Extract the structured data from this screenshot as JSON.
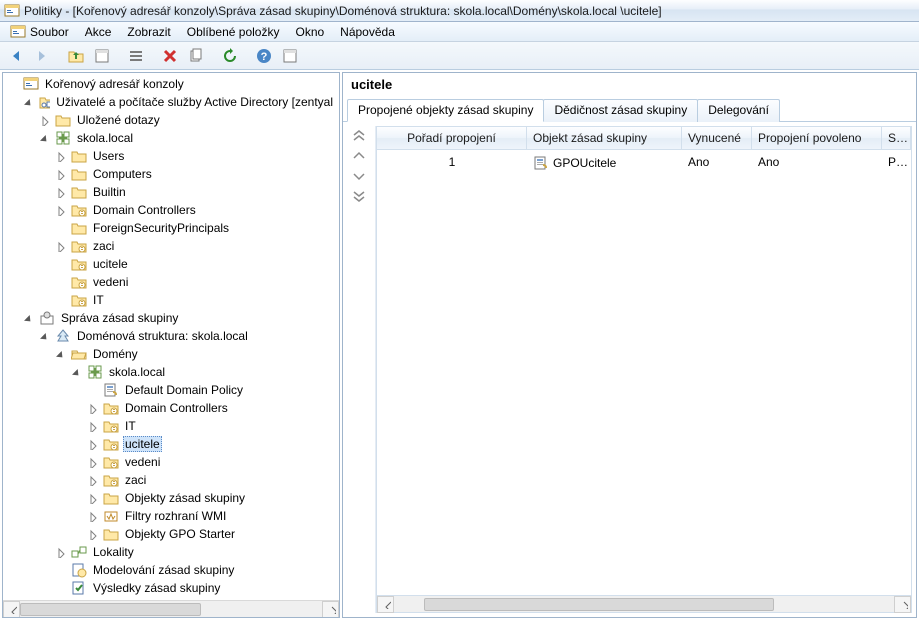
{
  "title": "Politiky - [Kořenový adresář konzoly\\Správa zásad skupiny\\Doménová struktura: skola.local\\Domény\\skola.local \\ucitele]",
  "menu": {
    "file": "Soubor",
    "action": "Akce",
    "view": "Zobrazit",
    "favorites": "Oblíbené položky",
    "window": "Okno",
    "help": "Nápověda"
  },
  "tree": {
    "root": "Kořenový adresář konzoly",
    "aduc": "Uživatelé a počítače služby Active Directory [zentyal",
    "savedQueries": "Uložené dotazy",
    "domain": "skola.local",
    "ou": {
      "users": "Users",
      "computers": "Computers",
      "builtin": "Builtin",
      "dc": "Domain Controllers",
      "fsp": "ForeignSecurityPrincipals",
      "zaci": "zaci",
      "ucitele": "ucitele",
      "vedeni": "vedeni",
      "it": "IT"
    },
    "gpm": "Správa zásad skupiny",
    "forest": "Doménová struktura: skola.local",
    "domains": "Domény",
    "domain2": "skola.local",
    "gpo": {
      "ddp": "Default Domain Policy",
      "dc": "Domain Controllers",
      "it": "IT",
      "ucitele": "ucitele",
      "vedeni": "vedeni",
      "zaci": "zaci",
      "objects": "Objekty zásad skupiny",
      "wmi": "Filtry rozhraní WMI",
      "starter": "Objekty GPO Starter"
    },
    "sites": "Lokality",
    "modeling": "Modelování zásad skupiny",
    "results": "Výsledky zásad skupiny"
  },
  "right": {
    "header": "ucitele",
    "tabs": {
      "linked": "Propojené objekty zásad skupiny",
      "inheritance": "Dědičnost zásad skupiny",
      "delegation": "Delegování"
    },
    "columns": {
      "order": "Pořadí propojení",
      "gpo": "Objekt zásad skupiny",
      "enforced": "Vynucené",
      "linkEnabled": "Propojení povoleno",
      "state": "Stav"
    },
    "rows": [
      {
        "order": "1",
        "gpo": "GPOUcitele",
        "enforced": "Ano",
        "linkEnabled": "Ano",
        "state": "Povo"
      }
    ]
  }
}
